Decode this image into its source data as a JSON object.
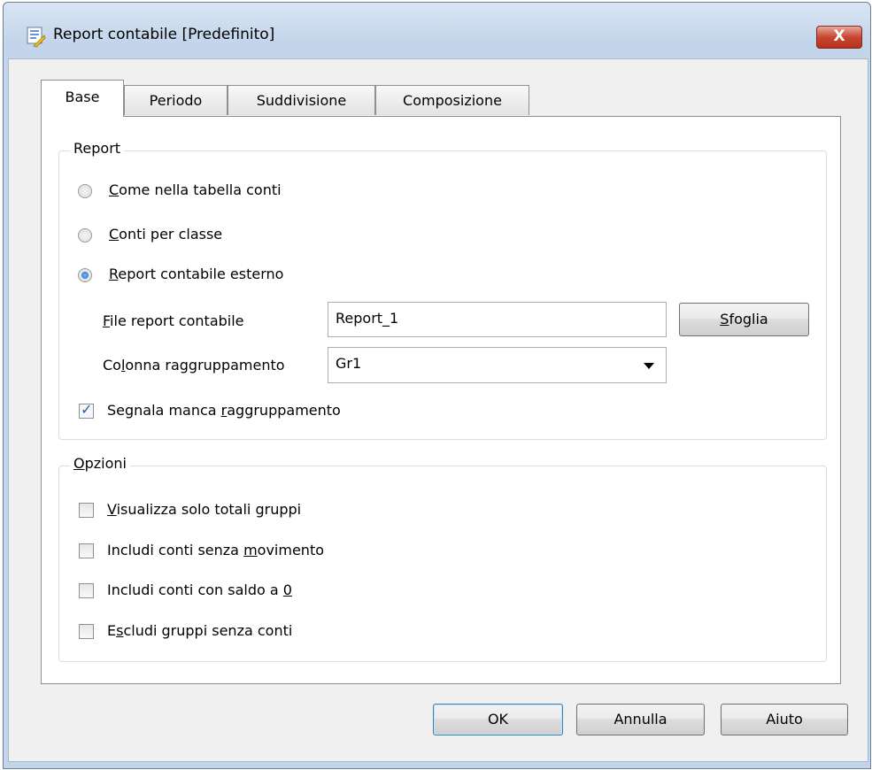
{
  "window": {
    "title": "Report contabile [Predefinito]",
    "close_glyph": "X",
    "icon": "report-app-icon"
  },
  "tabs": [
    {
      "label": "Base",
      "active": true
    },
    {
      "label": "Periodo",
      "active": false
    },
    {
      "label": "Suddivisione",
      "active": false
    },
    {
      "label": "Composizione",
      "active": false
    }
  ],
  "report_group": {
    "legend": "Report",
    "radios": [
      {
        "key": "C",
        "rest": "ome nella tabella conti",
        "selected": false
      },
      {
        "key": "C",
        "rest": "onti per classe",
        "selected": false
      },
      {
        "key": "R",
        "rest": "eport contabile esterno",
        "selected": true
      }
    ],
    "file_label": {
      "key": "F",
      "rest": "ile report contabile"
    },
    "file_value": "Report_1",
    "browse_button": {
      "key": "S",
      "rest": "foglia"
    },
    "column_label": {
      "pre": "Co",
      "key": "l",
      "rest": "onna raggruppamento"
    },
    "column_value": "Gr1",
    "signal_checkbox": {
      "pre": "Segnala manca ",
      "key": "r",
      "rest": "aggruppamento",
      "checked": true
    }
  },
  "options_group": {
    "legend": {
      "key": "O",
      "rest": "pzioni"
    },
    "checkboxes": [
      {
        "pre": "",
        "key": "V",
        "rest": "isualizza solo totali gruppi",
        "checked": false
      },
      {
        "pre": "Includi conti senza ",
        "key": "m",
        "rest": "ovimento",
        "checked": false
      },
      {
        "pre": "Includi conti con saldo a ",
        "key": "0",
        "rest": "",
        "checked": false
      },
      {
        "pre": "E",
        "key": "s",
        "rest": "cludi  gruppi senza conti",
        "checked": false
      }
    ]
  },
  "buttons": {
    "ok": "OK",
    "cancel": "Annulla",
    "help": "Aiuto"
  },
  "colors": {
    "accent": "#2a5ba7",
    "close": "#c7462f",
    "titlebar": "#c3d5eb"
  }
}
